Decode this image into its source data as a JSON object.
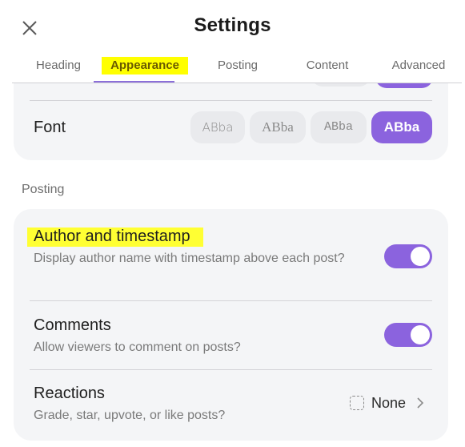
{
  "header": {
    "title": "Settings",
    "close_icon": "close-icon"
  },
  "tabs": [
    {
      "label": "Heading",
      "active": false
    },
    {
      "label": "Appearance",
      "active": true
    },
    {
      "label": "Posting",
      "active": false
    },
    {
      "label": "Content",
      "active": false
    },
    {
      "label": "Advanced",
      "active": false
    }
  ],
  "appearance": {
    "font": {
      "label": "Font",
      "options": [
        {
          "label": "ABba",
          "style": "sans-light",
          "selected": false
        },
        {
          "label": "ABba",
          "style": "serif",
          "selected": false
        },
        {
          "label": "ABba",
          "style": "mono",
          "selected": false
        },
        {
          "label": "ABba",
          "style": "sans-bold",
          "selected": true
        }
      ]
    }
  },
  "posting": {
    "section_label": "Posting",
    "items": [
      {
        "title": "Author and timestamp",
        "description": "Display author name with timestamp above each post?",
        "control": "toggle",
        "enabled": true,
        "highlighted": true
      },
      {
        "title": "Comments",
        "description": "Allow viewers to comment on posts?",
        "control": "toggle",
        "enabled": true
      },
      {
        "title": "Reactions",
        "description": "Grade, star, upvote, or like posts?",
        "control": "select",
        "value": "None",
        "value_icon": "dashed-square-icon"
      }
    ]
  },
  "colors": {
    "accent": "#8b63de",
    "highlight": "#ffff00",
    "card_bg": "#f4f5f7"
  }
}
